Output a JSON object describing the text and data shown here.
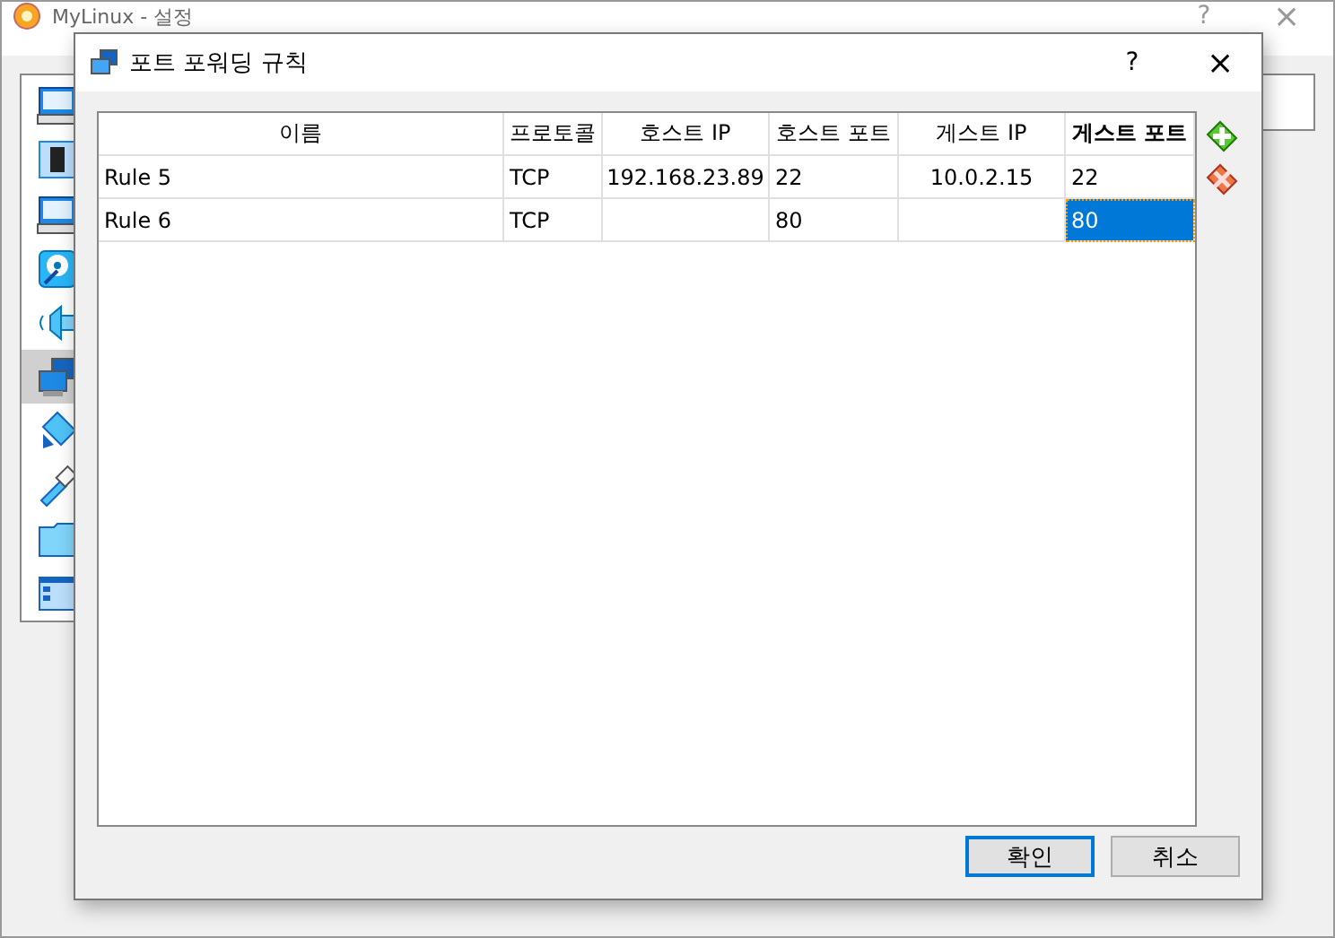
{
  "main_window": {
    "title": "MyLinux - 설정",
    "help": "?",
    "close": "×",
    "sidebar": [
      {
        "kind": "display",
        "selected": false
      },
      {
        "kind": "chip",
        "selected": false
      },
      {
        "kind": "display",
        "selected": false
      },
      {
        "kind": "disk",
        "selected": false
      },
      {
        "kind": "audio",
        "selected": false
      },
      {
        "kind": "network",
        "selected": true
      },
      {
        "kind": "serial",
        "selected": false
      },
      {
        "kind": "usb",
        "selected": false
      },
      {
        "kind": "folder",
        "selected": false
      },
      {
        "kind": "ui",
        "selected": false
      }
    ]
  },
  "dialog": {
    "title": "포트 포워딩 규칙",
    "help": "?",
    "close": "×",
    "table": {
      "columns": [
        {
          "label": "이름",
          "current": false
        },
        {
          "label": "프로토콜",
          "current": false
        },
        {
          "label": "호스트 IP",
          "current": false
        },
        {
          "label": "호스트 포트",
          "current": false
        },
        {
          "label": "게스트 IP",
          "current": false
        },
        {
          "label": "게스트 포트",
          "current": true
        }
      ],
      "rows": [
        {
          "cells": [
            {
              "text": "Rule 5",
              "selected": false
            },
            {
              "text": "TCP",
              "selected": false
            },
            {
              "text": "192.168.23.89",
              "selected": false
            },
            {
              "text": "22",
              "selected": false
            },
            {
              "text": "10.0.2.15",
              "selected": false
            },
            {
              "text": "22",
              "selected": false
            }
          ]
        },
        {
          "cells": [
            {
              "text": "Rule 6",
              "selected": false
            },
            {
              "text": "TCP",
              "selected": false
            },
            {
              "selected": false
            },
            {
              "text": "80",
              "selected": false
            },
            {
              "selected": false
            },
            {
              "text": "80",
              "selected": true
            }
          ]
        }
      ]
    },
    "buttons": [
      {
        "label": "확인",
        "default": true
      },
      {
        "label": "취소",
        "default": false
      }
    ]
  }
}
